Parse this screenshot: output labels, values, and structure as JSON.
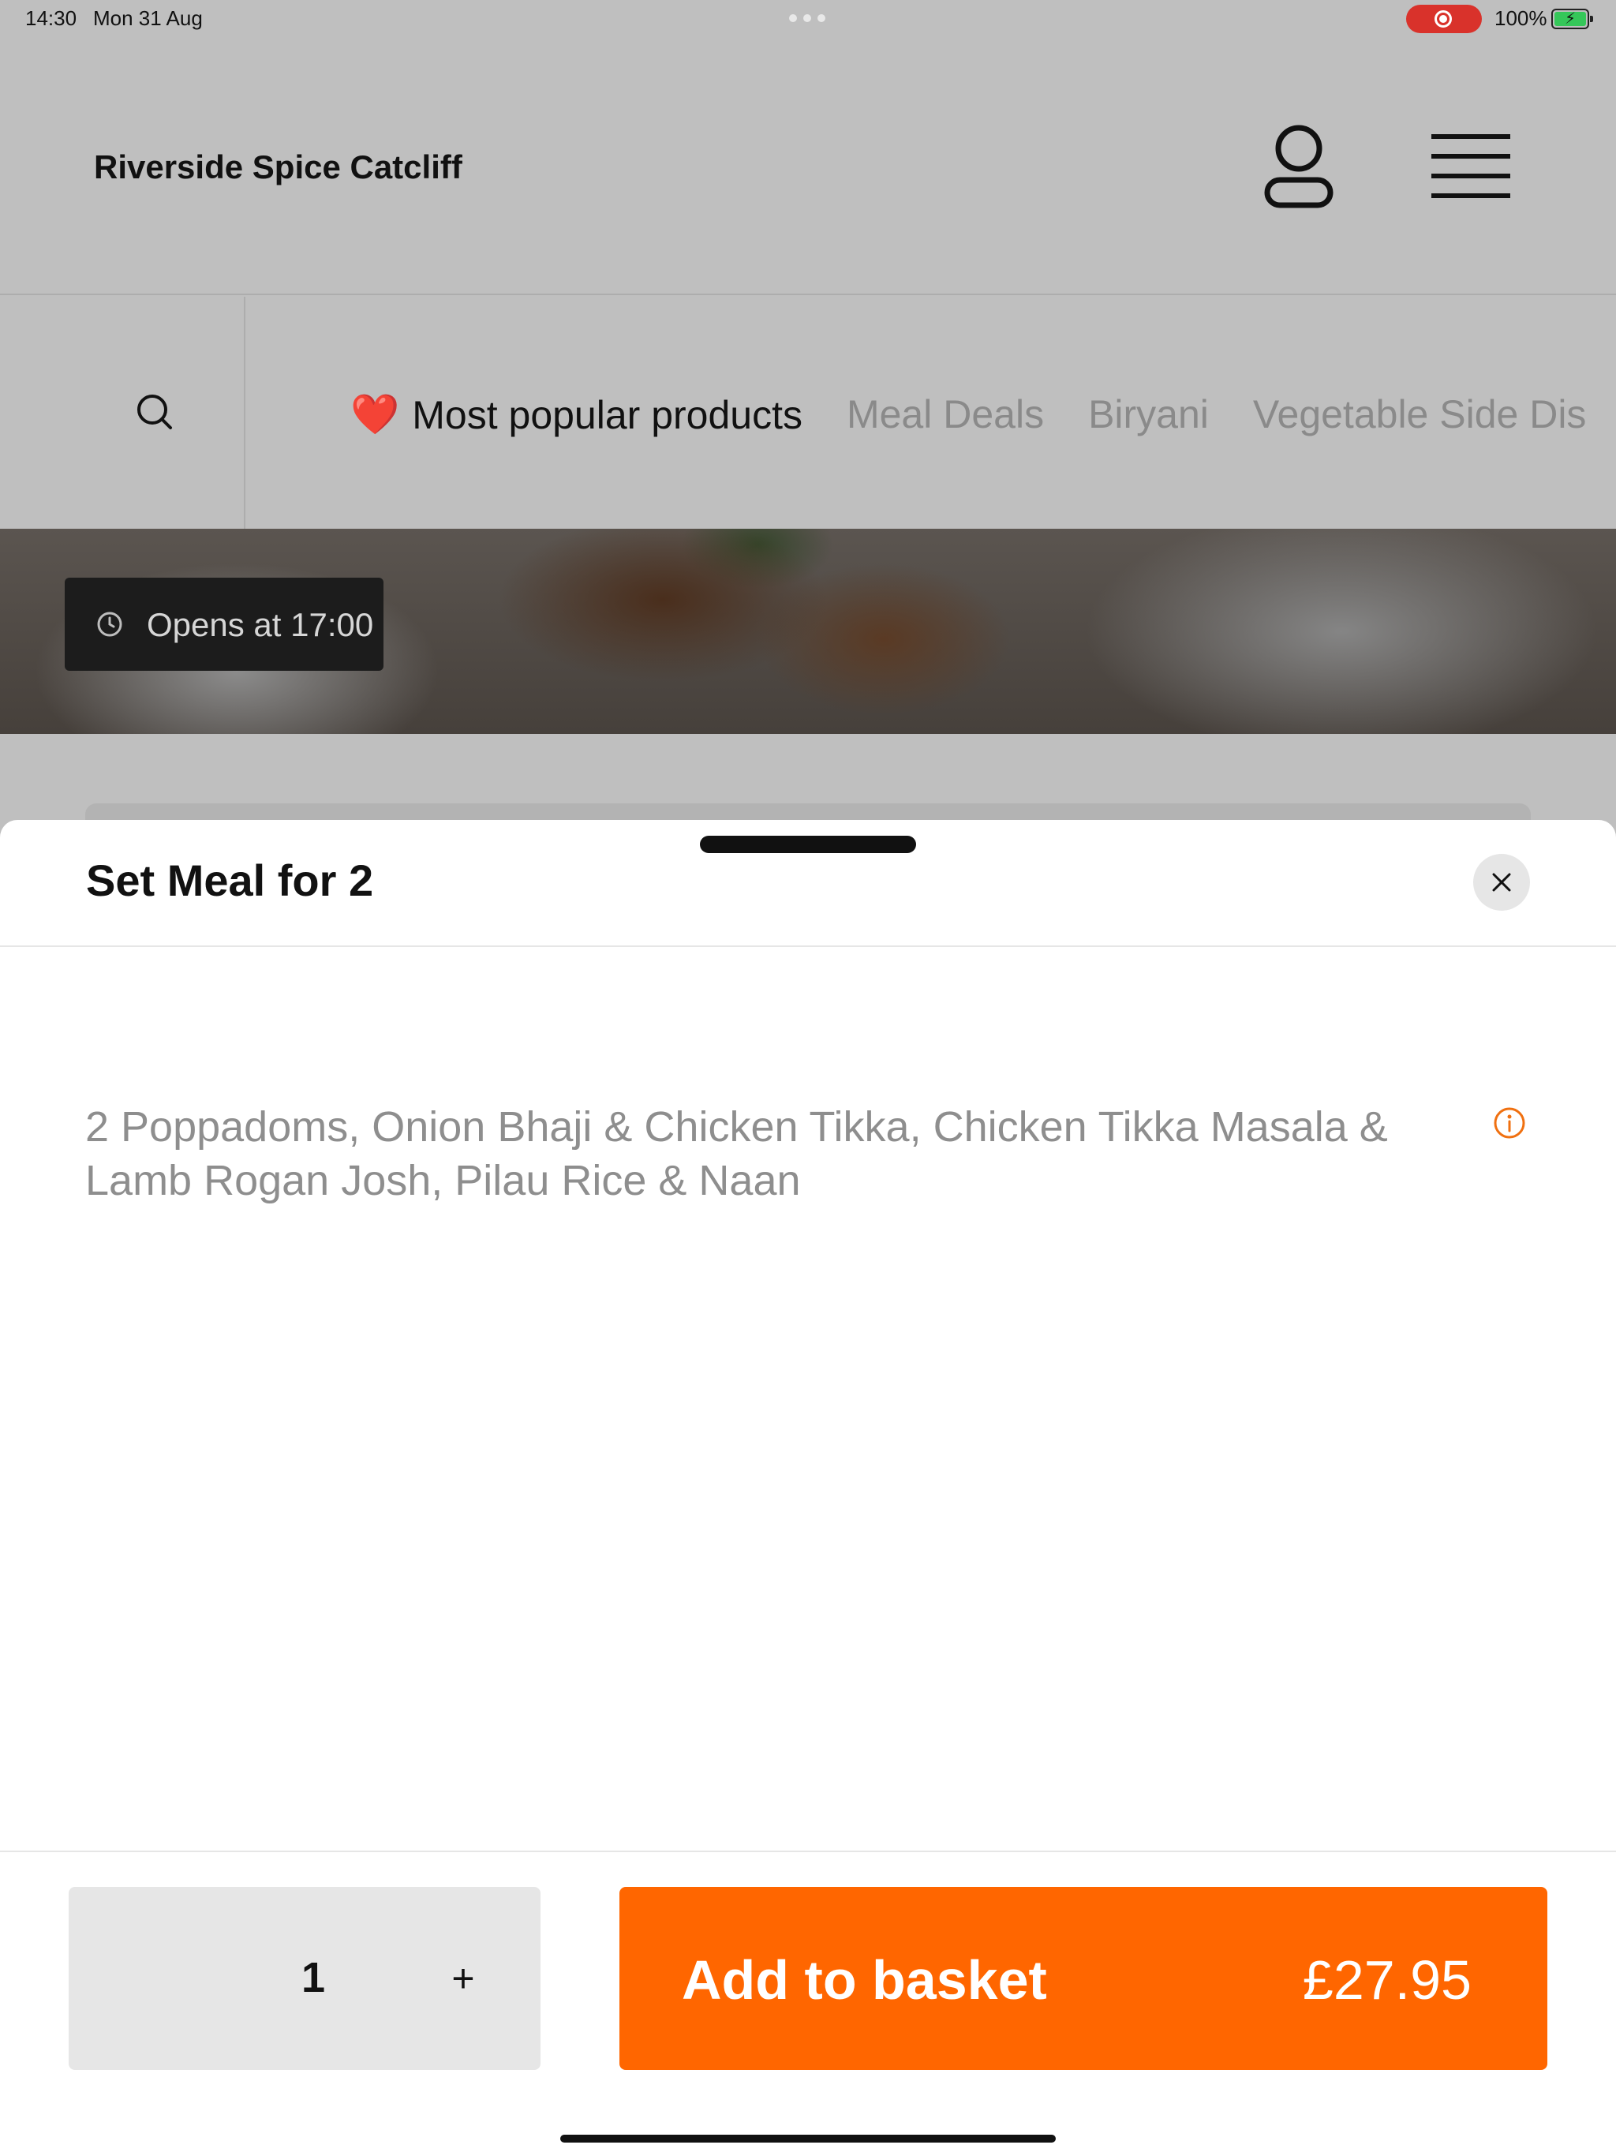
{
  "status_bar": {
    "time": "14:30",
    "date": "Mon 31 Aug",
    "battery": "100%"
  },
  "header": {
    "restaurant_name": "Riverside Spice Catcliff",
    "account_icon": "person-icon",
    "menu_icon": "hamburger-menu-icon"
  },
  "category_nav": {
    "search_icon": "search-icon",
    "tabs": [
      {
        "emoji": "❤️",
        "label": "Most popular products",
        "active": true
      },
      {
        "label": "Meal Deals",
        "active": false
      },
      {
        "label": "Biryani",
        "active": false
      },
      {
        "label": "Vegetable Side Dis",
        "active": false
      }
    ]
  },
  "hero": {
    "opens_text": "Opens at 17:00"
  },
  "sheet": {
    "title": "Set Meal for 2",
    "description": "2 Poppadoms, Onion Bhaji & Chicken Tikka, Chicken Tikka Masala & Lamb Rogan Josh, Pilau Rice & Naan",
    "quantity": "1",
    "plus_symbol": "+",
    "add_label": "Add to basket",
    "price": "£27.95"
  },
  "colors": {
    "accent": "#ff6600",
    "overlay_background": "#bfbfbf",
    "record_pill": "#d9322b",
    "battery_fill": "#35c759"
  }
}
